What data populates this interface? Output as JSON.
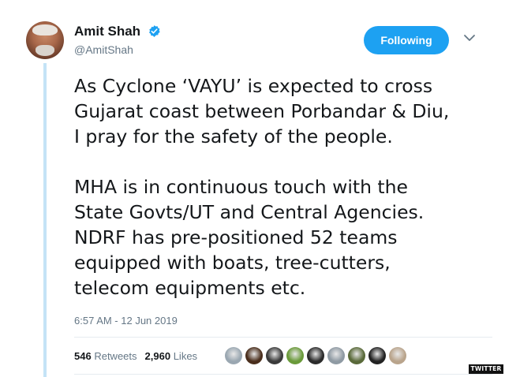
{
  "author": {
    "name": "Amit Shah",
    "handle": "@AmitShah",
    "verified": true
  },
  "follow_button": {
    "label": "Following"
  },
  "tweet": {
    "paragraph1": [
      "As Cyclone ‘VAYU’ is expected to cross",
      "Gujarat coast between Porbandar & Diu,",
      "I pray for the safety of the people."
    ],
    "paragraph2": [
      "MHA is in continuous touch with the",
      "State Govts/UT and Central Agencies.",
      "NDRF has pre-positioned 52 teams",
      "equipped with boats, tree-cutters,",
      "telecom equipments etc."
    ],
    "timestamp": "6:57 AM - 12 Jun 2019"
  },
  "stats": {
    "retweets_count": "546",
    "retweets_label": "Retweets",
    "likes_count": "2,960",
    "likes_label": "Likes"
  },
  "likers_avatar_colors": [
    "#9aa7b1",
    "#4a2e1c",
    "#3b3b3b",
    "#6a9a3a",
    "#2b2b2b",
    "#8f9aa3",
    "#5a6a3a",
    "#222222",
    "#b9a48c"
  ],
  "watermark": "TWITTER",
  "colors": {
    "accent": "#1da1f2",
    "thread_line": "#c4e3f6",
    "secondary_text": "#657786",
    "primary_text": "#14171a"
  }
}
